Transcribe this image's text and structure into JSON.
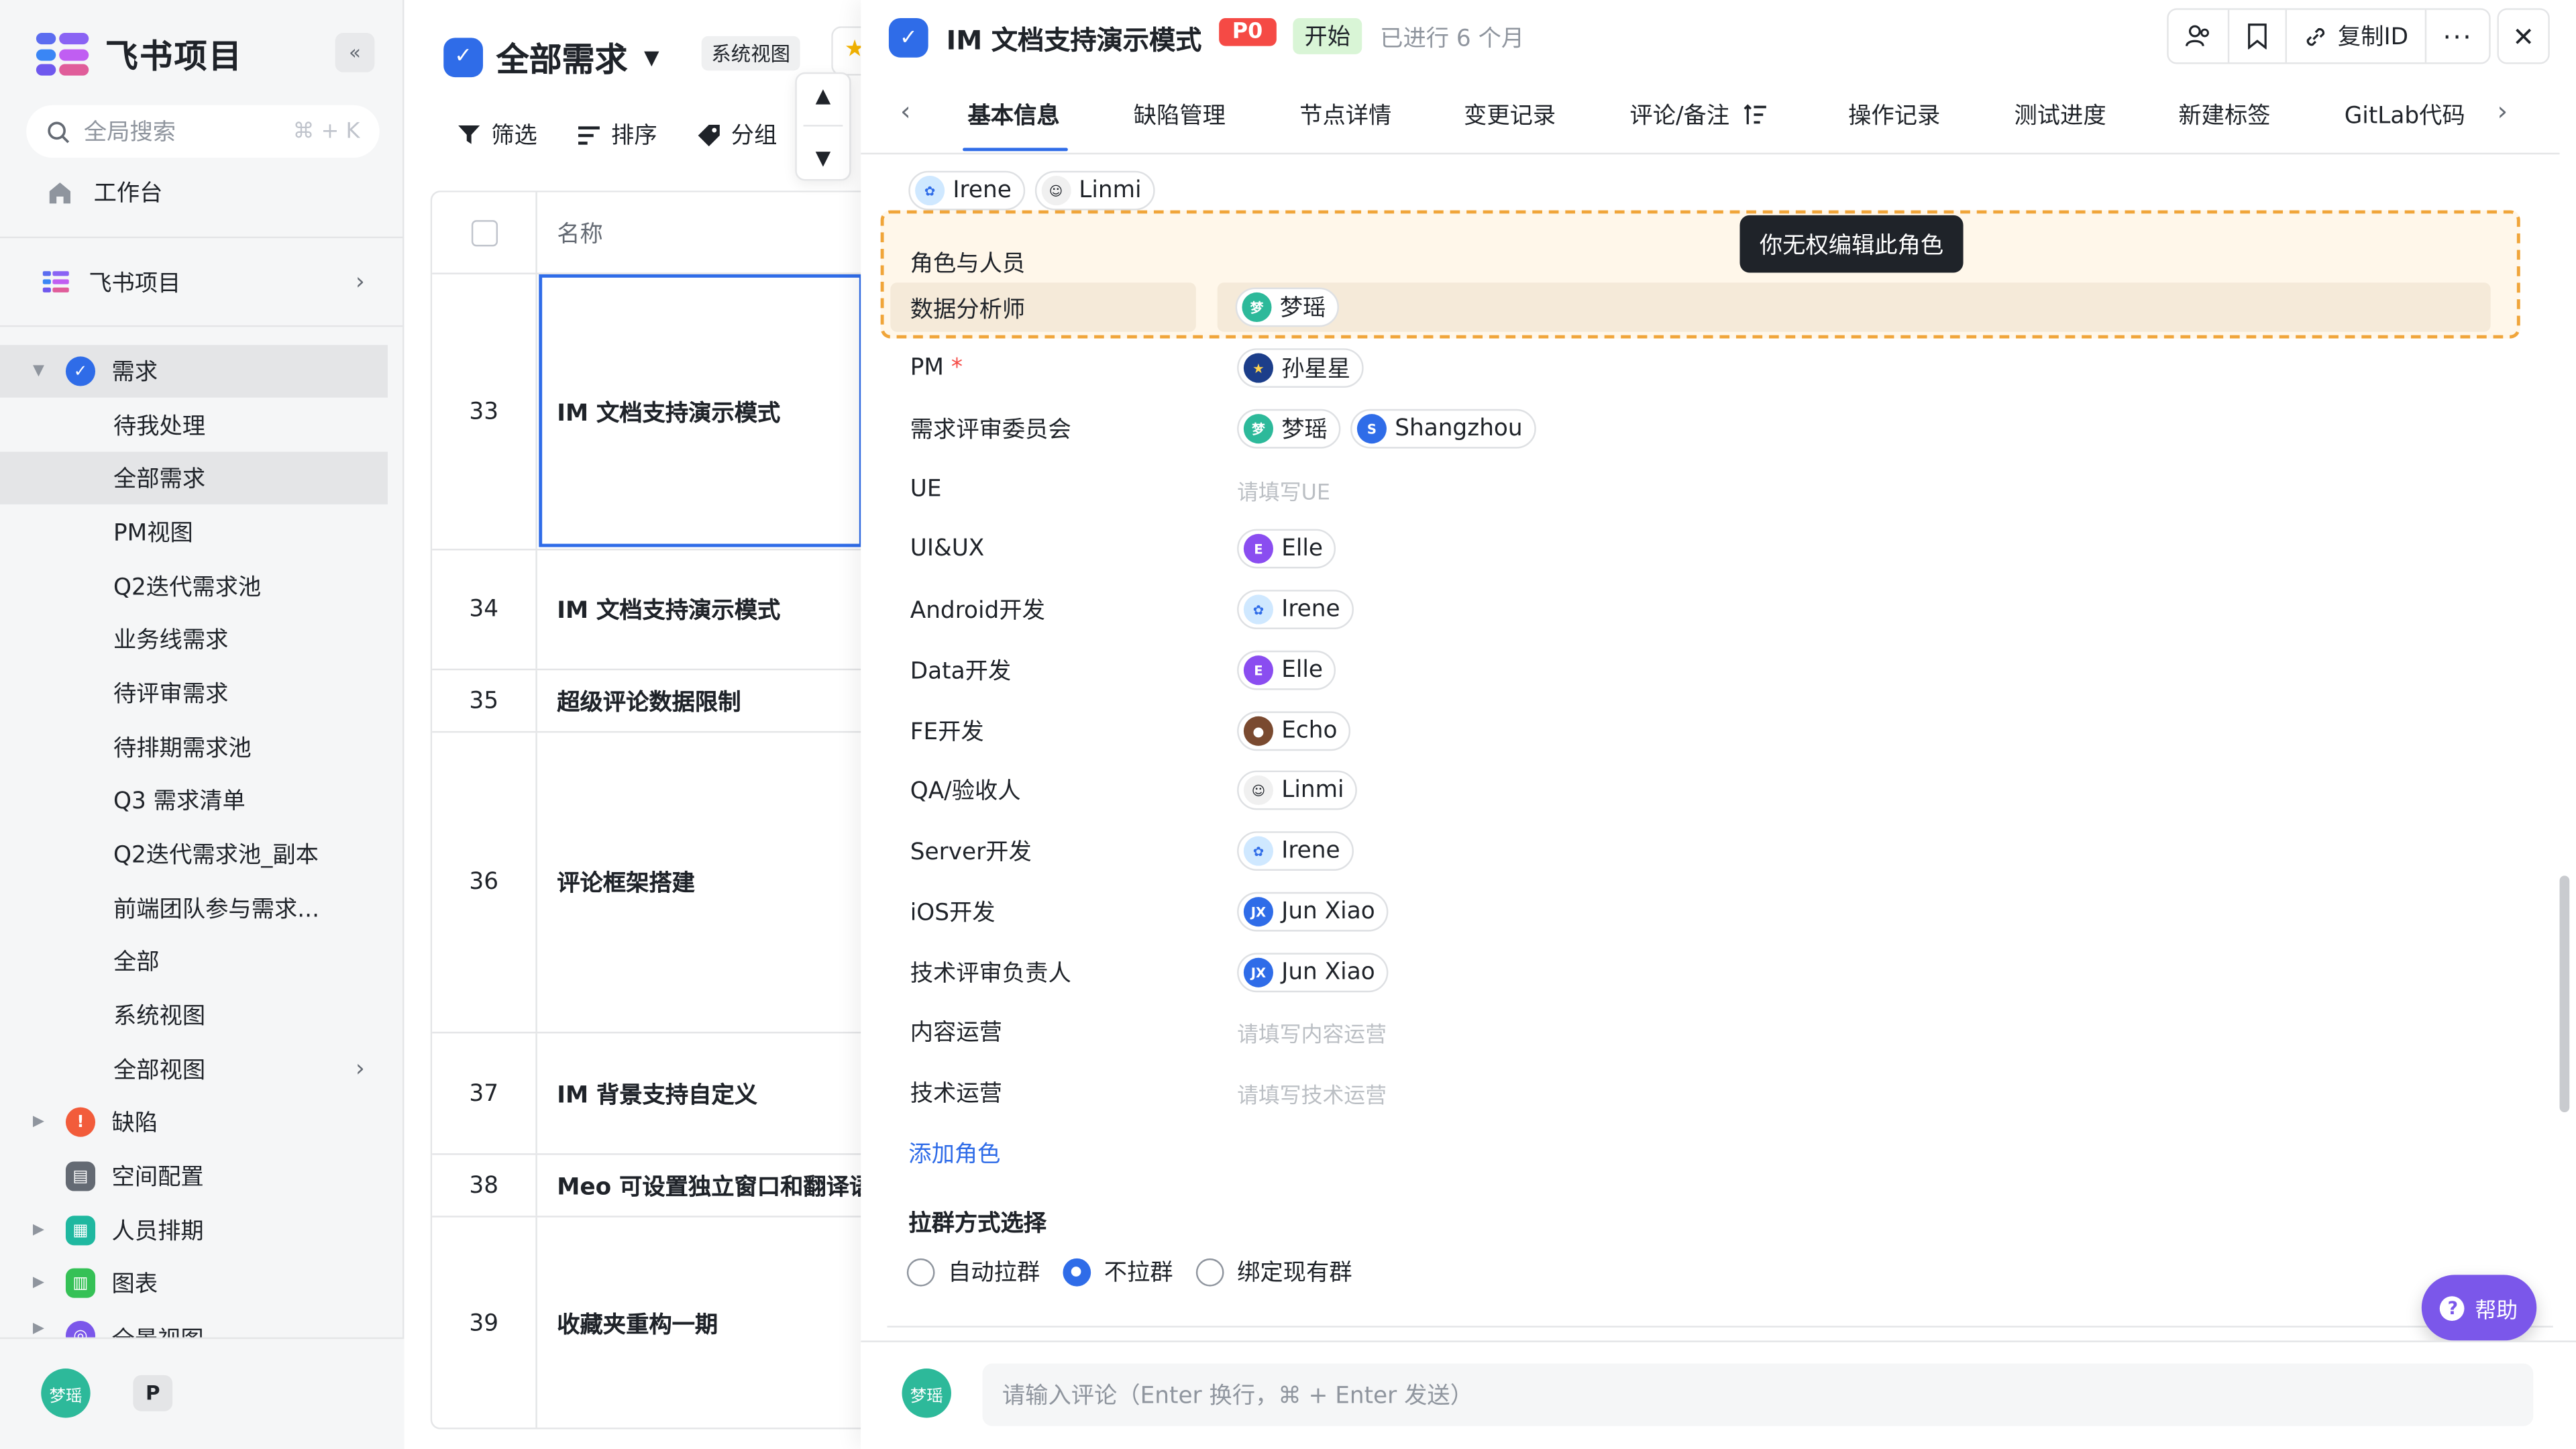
{
  "brand": {
    "name": "飞书项目",
    "collapse_icon": "double-chevron-left-icon"
  },
  "search": {
    "placeholder": "全局搜索",
    "shortcut": "⌘ + K"
  },
  "sidebar": {
    "workbench": "工作台",
    "space": "飞书项目",
    "items": [
      {
        "label": "需求",
        "type": "group",
        "color": "#2f6ce8"
      },
      {
        "label": "待我处理"
      },
      {
        "label": "全部需求"
      },
      {
        "label": "PM视图"
      },
      {
        "label": "Q2迭代需求池"
      },
      {
        "label": "业务线需求"
      },
      {
        "label": "待评审需求"
      },
      {
        "label": "待排期需求池"
      },
      {
        "label": "Q3 需求清单"
      },
      {
        "label": "Q2迭代需求池_副本"
      },
      {
        "label": "前端团队参与需求..."
      },
      {
        "label": "全部"
      },
      {
        "label": "系统视图"
      },
      {
        "label": "全部视图"
      },
      {
        "label": "缺陷",
        "type": "group",
        "color": "#f25c3b"
      },
      {
        "label": "空间配置",
        "type": "group",
        "color": "#646a73"
      },
      {
        "label": "人员排期",
        "type": "group",
        "color": "#1fb8a0"
      },
      {
        "label": "图表",
        "type": "group",
        "color": "#35c156"
      },
      {
        "label": "全景视图",
        "type": "group",
        "color": "#7b57ea"
      }
    ],
    "user_avatar": "梦瑶",
    "extra_avatar": "P"
  },
  "list": {
    "title": "全部需求",
    "view_tag": "系统视图",
    "toolbar": {
      "filter": "筛选",
      "sort": "排序",
      "group": "分组"
    },
    "column_name": "名称",
    "rows": [
      {
        "id": "33",
        "name": "IM 文档支持演示模式"
      },
      {
        "id": "34",
        "name": "IM 文档支持演示模式"
      },
      {
        "id": "35",
        "name": "超级评论数据限制"
      },
      {
        "id": "36",
        "name": "评论框架搭建"
      },
      {
        "id": "37",
        "name": "IM 背景支持自定义"
      },
      {
        "id": "38",
        "name": "Meo 可设置独立窗口和翻译语"
      },
      {
        "id": "39",
        "name": "收藏夹重构一期"
      }
    ]
  },
  "detail": {
    "title": "IM 文档支持演示模式",
    "priority": "P0",
    "status": "开始",
    "elapsed": "已进行 6 个月",
    "header_buttons": {
      "copy_id": "复制ID"
    },
    "tabs": [
      "基本信息",
      "缺陷管理",
      "节点详情",
      "变更记录",
      "评论/备注",
      "操作记录",
      "测试进度",
      "新建标签",
      "GitLab代码"
    ],
    "top_people": [
      {
        "name": "Irene",
        "avatar": "irene"
      },
      {
        "name": "Linmi",
        "avatar": "linmi"
      }
    ],
    "roles_section_title": "角色与人员",
    "tooltip": "你无权编辑此角色",
    "roles": [
      {
        "label": "数据分析师",
        "people": [
          {
            "name": "梦瑶",
            "avatar": "mengyao"
          }
        ],
        "required": false
      },
      {
        "label": "PM",
        "people": [
          {
            "name": "孙星星",
            "avatar": "star"
          }
        ],
        "required": true
      },
      {
        "label": "需求评审委员会",
        "people": [
          {
            "name": "梦瑶",
            "avatar": "mengyao"
          },
          {
            "name": "Shangzhou",
            "avatar": "s"
          }
        ],
        "required": false
      },
      {
        "label": "UE",
        "people": [],
        "placeholder": "请填写UE"
      },
      {
        "label": "UI&UX",
        "people": [
          {
            "name": "Elle",
            "avatar": "e"
          }
        ]
      },
      {
        "label": "Android开发",
        "people": [
          {
            "name": "Irene",
            "avatar": "irene"
          }
        ]
      },
      {
        "label": "Data开发",
        "people": [
          {
            "name": "Elle",
            "avatar": "e"
          }
        ]
      },
      {
        "label": "FE开发",
        "people": [
          {
            "name": "Echo",
            "avatar": "echo"
          }
        ]
      },
      {
        "label": "QA/验收人",
        "people": [
          {
            "name": "Linmi",
            "avatar": "linmi"
          }
        ]
      },
      {
        "label": "Server开发",
        "people": [
          {
            "name": "Irene",
            "avatar": "irene"
          }
        ]
      },
      {
        "label": "iOS开发",
        "people": [
          {
            "name": "Jun Xiao",
            "avatar": "jx"
          }
        ]
      },
      {
        "label": "技术评审负责人",
        "people": [
          {
            "name": "Jun Xiao",
            "avatar": "jx"
          }
        ]
      },
      {
        "label": "内容运营",
        "people": [],
        "placeholder": "请填写内容运营"
      },
      {
        "label": "技术运营",
        "people": [],
        "placeholder": "请填写技术运营"
      }
    ],
    "add_role": "添加角色",
    "group_method": {
      "title": "拉群方式选择",
      "options": [
        "自动拉群",
        "不拉群",
        "绑定现有群"
      ],
      "selected": "不拉群"
    },
    "comment_placeholder": "请输入评论（Enter 换行，⌘ + Enter 发送）",
    "commenter": "梦瑶",
    "help": "帮助"
  },
  "colors": {
    "accent": "#2f6ce8",
    "danger": "#f54a45",
    "highlight_border": "#f0a53a"
  }
}
